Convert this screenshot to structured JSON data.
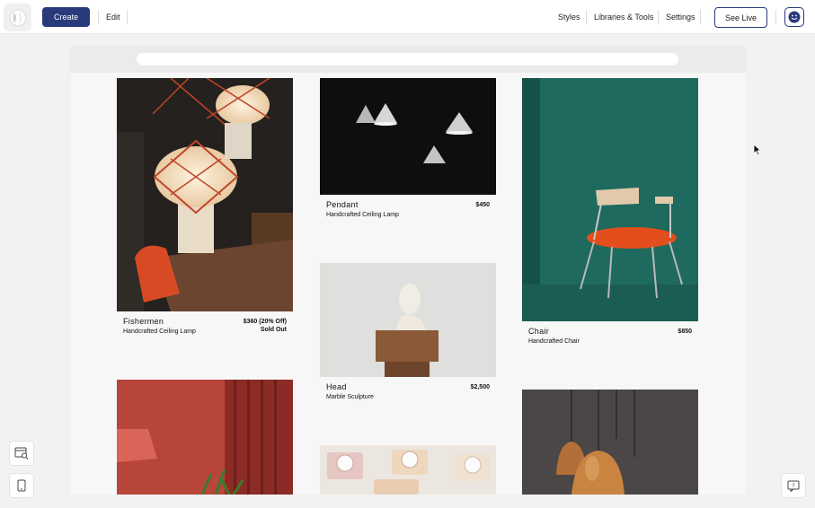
{
  "topbar": {
    "create_label": "Create",
    "edit_label": "Edit",
    "styles_label": "Styles",
    "libraries_label": "Libraries & Tools",
    "settings_label": "Settings",
    "see_live_label": "See Live"
  },
  "products": [
    {
      "title": "Fishermen",
      "subtitle": "Handcrafted Ceiling Lamp",
      "price": "$360 (20% Off)",
      "status": "Sold Out"
    },
    {
      "title": "Pendant",
      "subtitle": "Handcrafted Ceiling Lamp",
      "price": "$450"
    },
    {
      "title": "Head",
      "subtitle": "Marble Sculpture",
      "price": "$2,500"
    },
    {
      "title": "Chair",
      "subtitle": "Handcrafted Chair",
      "price": "$850"
    }
  ],
  "colors": {
    "accent": "#283a7a",
    "page_bg": "#f7f7f8"
  },
  "icons": {
    "logo": "logo-icon",
    "avatar": "smiley-icon",
    "browser_search": "browser-search-icon",
    "mobile": "mobile-icon",
    "help": "help-icon"
  }
}
